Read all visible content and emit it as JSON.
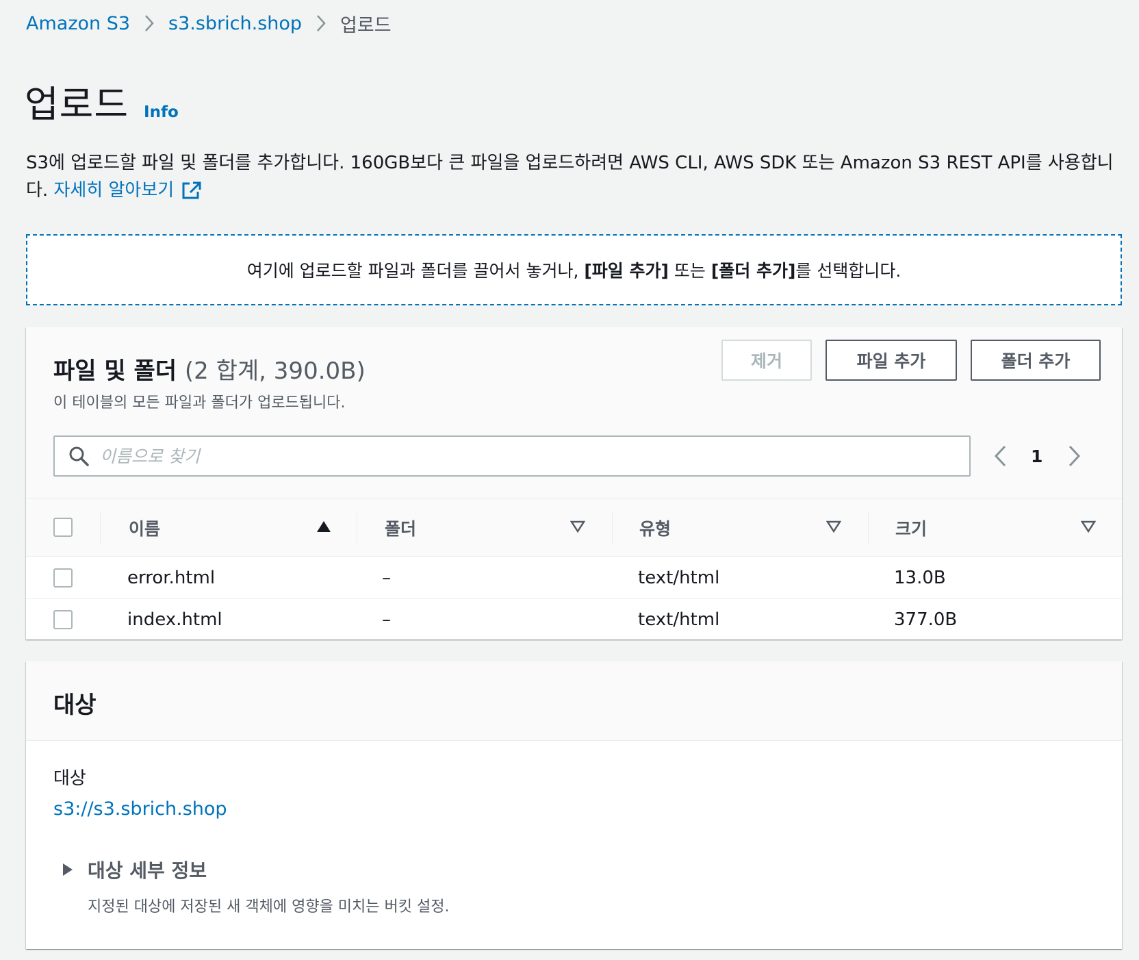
{
  "breadcrumb": {
    "items": [
      {
        "label": "Amazon S3"
      },
      {
        "label": "s3.sbrich.shop"
      },
      {
        "label": "업로드"
      }
    ]
  },
  "page": {
    "title": "업로드",
    "info_link": "Info",
    "description": "S3에 업로드할 파일 및 폴더를 추가합니다. 160GB보다 큰 파일을 업로드하려면 AWS CLI, AWS SDK 또는 Amazon S3 REST API를 사용합니다.",
    "learn_more": "자세히 알아보기"
  },
  "dropzone": {
    "text_before": "여기에 업로드할 파일과 폴더를 끌어서 놓거나, ",
    "add_files_bracket": "[파일 추가]",
    "text_or": " 또는 ",
    "add_folder_bracket": "[폴더 추가]",
    "text_after": "를 선택합니다."
  },
  "files": {
    "title": "파일 및 폴더",
    "count": "(2 합계, 390.0B)",
    "subtitle": "이 테이블의 모든 파일과 폴더가 업로드됩니다.",
    "buttons": {
      "remove": "제거",
      "add_files": "파일 추가",
      "add_folder": "폴더 추가"
    },
    "search_placeholder": "이름으로 찾기",
    "page": "1",
    "columns": {
      "name": "이름",
      "folder": "폴더",
      "type": "유형",
      "size": "크기"
    },
    "rows": [
      {
        "name": "error.html",
        "folder": "–",
        "type": "text/html",
        "size": "13.0B"
      },
      {
        "name": "index.html",
        "folder": "–",
        "type": "text/html",
        "size": "377.0B"
      }
    ]
  },
  "destination": {
    "title": "대상",
    "label": "대상",
    "value": "s3://s3.sbrich.shop",
    "details_label": "대상 세부 정보",
    "details_desc": "지정된 대상에 저장된 새 객체에 영향을 미치는 버킷 설정."
  },
  "colors": {
    "link": "#0073bb",
    "text": "#16191f",
    "secondary_text": "#545b64",
    "background": "#f2f3f3"
  }
}
